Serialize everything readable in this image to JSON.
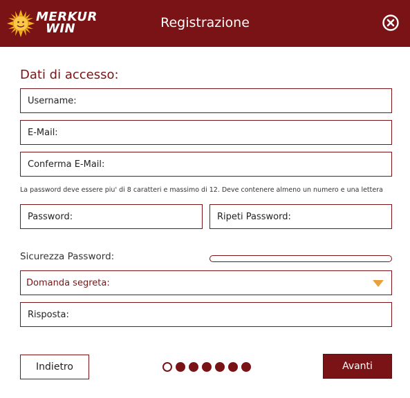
{
  "header": {
    "logo_line1": "MERKUR",
    "logo_line2": "WIN",
    "title": "Registrazione",
    "close_icon": "close-circle-icon"
  },
  "section": {
    "title": "Dati di accesso:"
  },
  "fields": {
    "username": "Username:",
    "email": "E-Mail:",
    "confirm_email": "Conferma E-Mail:",
    "password_hint": "La password deve essere piu' di 8 caratteri e massimo di 12. Deve contenere almeno un numero e una lettera",
    "password": "Password:",
    "repeat_password": "Ripeti Password:",
    "answer": "Risposta:"
  },
  "strength": {
    "label": "Sicurezza Password:",
    "level": 0
  },
  "secret_question": {
    "selected": "Domanda segreta:",
    "arrow_icon": "dropdown-arrow-icon"
  },
  "footer": {
    "back_label": "Indietro",
    "next_label": "Avanti",
    "steps_total": 7,
    "current_step": 1
  },
  "colors": {
    "brand": "#7a1315",
    "arrow": "#e8a13a",
    "background": "#ffffff"
  }
}
